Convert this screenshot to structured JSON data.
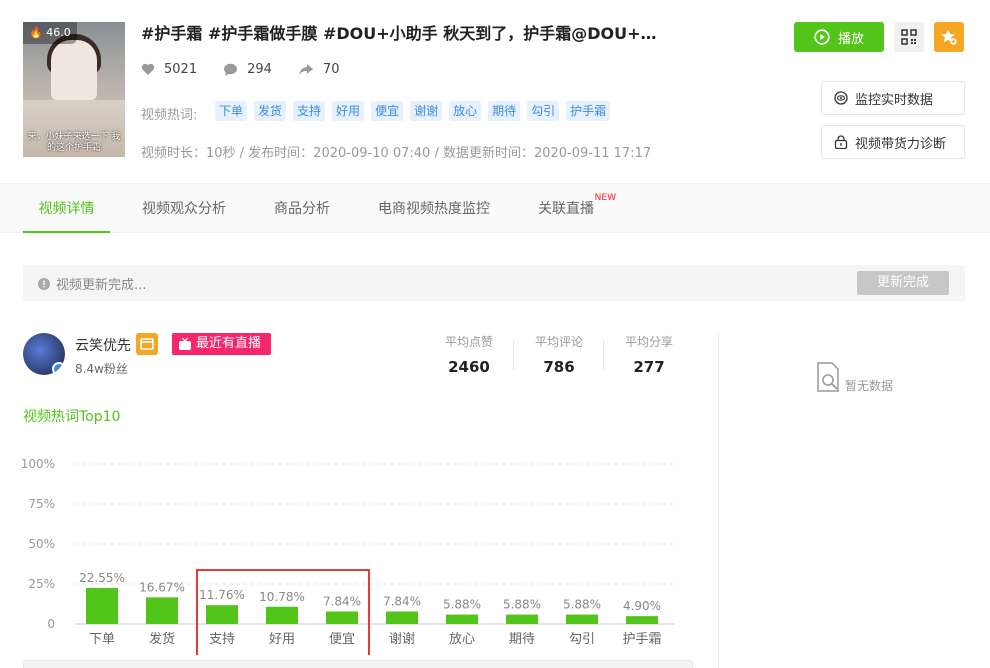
{
  "video": {
    "heat": "46.0",
    "thumb_caption": "来，小妹子来选一下 我的这个护手霜",
    "title": "#护手霜 #护手霜做手膜 #DOU+小助手 秋天到了，护手霜@DOU+…",
    "likes": "5021",
    "comments": "294",
    "shares": "70",
    "hot_label": "视频热词:",
    "tags": [
      "下单",
      "发货",
      "支持",
      "好用",
      "便宜",
      "谢谢",
      "放心",
      "期待",
      "勾引",
      "护手霜"
    ],
    "meta": "视频时长：10秒 / 发布时间：2020-09-10 07:40 / 数据更新时间：2020-09-11 17:17"
  },
  "actions": {
    "play": "播放",
    "monitor": "监控实时数据",
    "diagnose": "视频带货力诊断"
  },
  "tabs": [
    {
      "label": "视频详情",
      "active": true
    },
    {
      "label": "视频观众分析",
      "active": false
    },
    {
      "label": "商品分析",
      "active": false
    },
    {
      "label": "电商视频热度监控",
      "active": false
    },
    {
      "label": "关联直播",
      "active": false,
      "badge": "NEW"
    }
  ],
  "status": {
    "text": "视频更新完成...",
    "button": "更新完成"
  },
  "author": {
    "name": "云笑优先",
    "fans": "8.4w粉丝",
    "live_badge": "最近有直播",
    "avg_likes_label": "平均点赞",
    "avg_likes": "2460",
    "avg_comments_label": "平均评论",
    "avg_comments": "786",
    "avg_shares_label": "平均分享",
    "avg_shares": "277"
  },
  "side_panel": {
    "empty_text": "暂无数据"
  },
  "colors": {
    "accent": "#52c41a",
    "tag_bg": "#e6f1fd",
    "tag_text": "#3d8de0",
    "live": "#f5286e",
    "highlight_box": "#e53935"
  },
  "chart_data": {
    "type": "bar",
    "title": "视频热词Top10",
    "categories": [
      "下单",
      "发货",
      "支持",
      "好用",
      "便宜",
      "谢谢",
      "放心",
      "期待",
      "勾引",
      "护手霜"
    ],
    "values": [
      22.55,
      16.67,
      11.76,
      10.78,
      7.84,
      7.84,
      5.88,
      5.88,
      5.88,
      4.9
    ],
    "value_labels": [
      "22.55%",
      "16.67%",
      "11.76%",
      "10.78%",
      "7.84%",
      "7.84%",
      "5.88%",
      "5.88%",
      "5.88%",
      "4.90%"
    ],
    "y_ticks": [
      "0",
      "25%",
      "50%",
      "75%",
      "100%"
    ],
    "ylim": [
      0,
      100
    ],
    "grid": true,
    "highlighted_categories": [
      "支持",
      "好用",
      "便宜"
    ]
  }
}
